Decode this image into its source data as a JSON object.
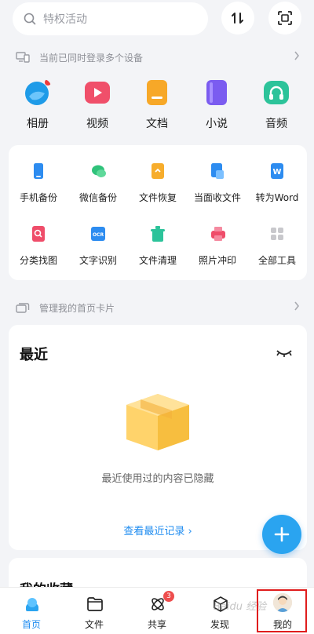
{
  "search": {
    "placeholder": "特权活动"
  },
  "devices": {
    "text": "当前已同时登录多个设备"
  },
  "media": [
    {
      "label": "相册",
      "icon": "photo-album-icon",
      "color": "#1e9be8"
    },
    {
      "label": "视频",
      "icon": "video-icon",
      "color": "#f04f6a"
    },
    {
      "label": "文档",
      "icon": "document-icon",
      "color": "#f7a828"
    },
    {
      "label": "小说",
      "icon": "book-icon",
      "color": "#7b5cf0"
    },
    {
      "label": "音频",
      "icon": "headphones-icon",
      "color": "#2cc39a"
    }
  ],
  "tools": [
    {
      "label": "手机备份",
      "icon": "phone-backup-icon",
      "color": "#2d8cf0"
    },
    {
      "label": "微信备份",
      "icon": "wechat-backup-icon",
      "color": "#2fc27a"
    },
    {
      "label": "文件恢复",
      "icon": "file-restore-icon",
      "color": "#f7ad2c"
    },
    {
      "label": "当面收文件",
      "icon": "receive-file-icon",
      "color": "#2d8cf0"
    },
    {
      "label": "转为Word",
      "icon": "word-convert-icon",
      "color": "#2d8cf0"
    },
    {
      "label": "分类找图",
      "icon": "classify-image-icon",
      "color": "#ef4d6a"
    },
    {
      "label": "文字识别",
      "icon": "ocr-icon",
      "color": "#2d8cf0"
    },
    {
      "label": "文件清理",
      "icon": "file-clean-icon",
      "color": "#2cc39a"
    },
    {
      "label": "照片冲印",
      "icon": "photo-print-icon",
      "color": "#ef4d6a"
    },
    {
      "label": "全部工具",
      "icon": "all-tools-icon",
      "color": "#c8c8cc"
    }
  ],
  "manage": {
    "text": "管理我的首页卡片"
  },
  "recent": {
    "title": "最近",
    "hidden_text": "最近使用过的内容已隐藏",
    "link_text": "查看最近记录 ›"
  },
  "favorites": {
    "title": "我的收藏"
  },
  "nav": [
    {
      "label": "首页",
      "icon": "home-icon",
      "active": true
    },
    {
      "label": "文件",
      "icon": "folder-icon"
    },
    {
      "label": "共享",
      "icon": "share-icon",
      "badge": "3"
    },
    {
      "label": "发现",
      "icon": "discover-icon"
    },
    {
      "label": "我的",
      "icon": "avatar-icon"
    }
  ],
  "watermark": "Baidu 经验",
  "colors": {
    "accent": "#1f8cf0",
    "fab": "#2aa4f0",
    "highlight": "#e01d1d"
  }
}
